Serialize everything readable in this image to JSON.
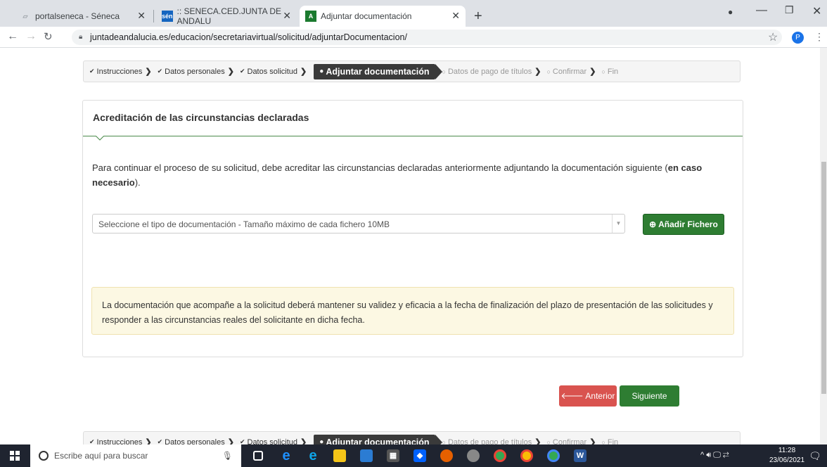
{
  "browser": {
    "tabs": [
      {
        "title": "portalseneca - Séneca",
        "icon": "document-icon"
      },
      {
        "title": ":: SENECA.CED.JUNTA DE ANDALU",
        "icon": "seneca-logo-icon"
      },
      {
        "title": "Adjuntar documentación",
        "icon": "junta-logo-icon"
      }
    ],
    "url": "juntadeandalucia.es/educacion/secretariavirtual/solicitud/adjuntarDocumentacion/",
    "profile_initial": "P"
  },
  "steps": [
    {
      "label": "Instrucciones",
      "state": "done"
    },
    {
      "label": "Datos personales",
      "state": "done"
    },
    {
      "label": "Datos solicitud",
      "state": "done"
    },
    {
      "label": "Adjuntar documentación",
      "state": "current"
    },
    {
      "label": "Datos de pago de títulos",
      "state": "pending"
    },
    {
      "label": "Confirmar",
      "state": "pending"
    },
    {
      "label": "Fin",
      "state": "pending"
    }
  ],
  "panel": {
    "title": "Acreditación de las circunstancias declaradas",
    "intro_text": "Para continuar el proceso de su solicitud, debe acreditar las circunstancias declaradas anteriormente adjuntando la documentación siguiente (",
    "intro_bold": "en caso necesario",
    "intro_end": ").",
    "select_value": "Seleccione el tipo de documentación - Tamaño máximo de cada fichero 10MB",
    "add_button": "Añadir Fichero",
    "notice": "La documentación que acompañe a la solicitud deberá mantener su validez y eficacia a la fecha de finalización del plazo de presentación de las solicitudes y responder a las circunstancias reales del solicitante en dicha fecha."
  },
  "buttons": {
    "previous": "Anterior",
    "next": "Siguiente"
  },
  "taskbar": {
    "search_placeholder": "Escribe aquí para buscar",
    "time": "11:28",
    "date": "23/06/2021"
  },
  "colors": {
    "primary_green": "#2e7d32",
    "danger_red": "#d9534f",
    "notice_bg": "#fcf8e3"
  }
}
